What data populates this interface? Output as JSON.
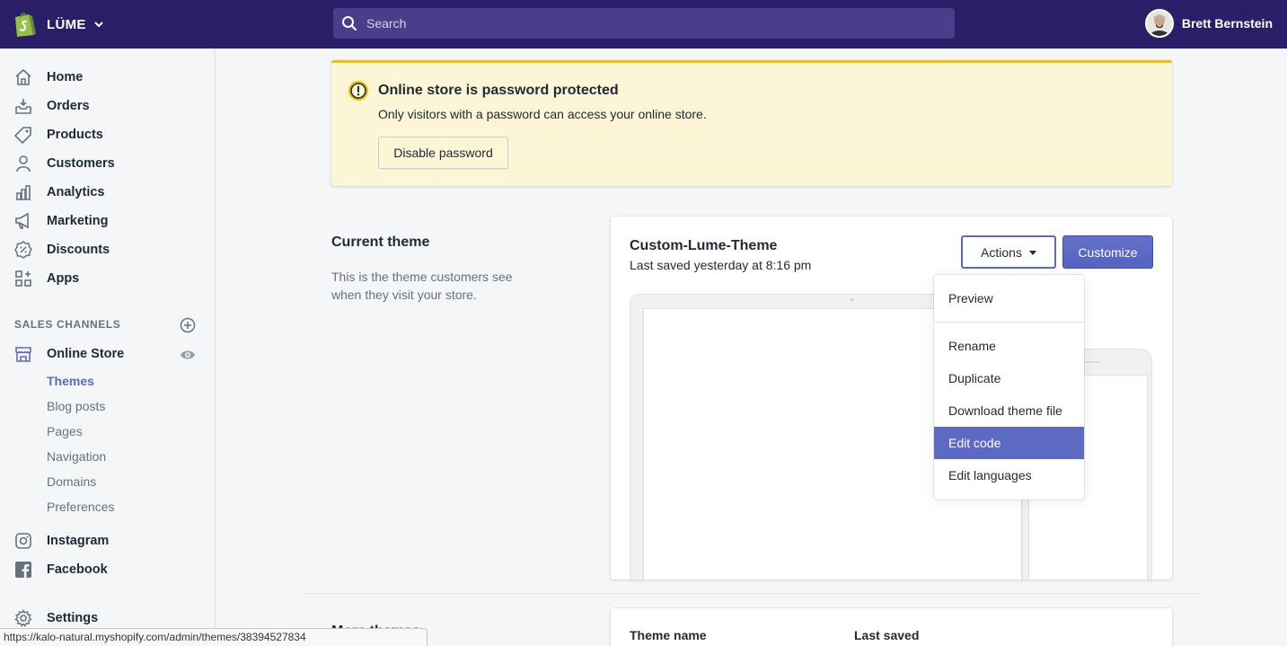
{
  "topbar": {
    "store_name": "LÜME",
    "search_placeholder": "Search",
    "user_name": "Brett Bernstein"
  },
  "sidebar": {
    "items": [
      {
        "label": "Home",
        "icon": "home-icon"
      },
      {
        "label": "Orders",
        "icon": "orders-icon"
      },
      {
        "label": "Products",
        "icon": "tag-icon"
      },
      {
        "label": "Customers",
        "icon": "person-icon"
      },
      {
        "label": "Analytics",
        "icon": "bar-chart-icon"
      },
      {
        "label": "Marketing",
        "icon": "megaphone-icon"
      },
      {
        "label": "Discounts",
        "icon": "discount-icon"
      },
      {
        "label": "Apps",
        "icon": "apps-icon"
      }
    ],
    "sales_channels_heading": "SALES CHANNELS",
    "online_store": "Online Store",
    "sub_items": [
      "Themes",
      "Blog posts",
      "Pages",
      "Navigation",
      "Domains",
      "Preferences"
    ],
    "instagram": "Instagram",
    "facebook": "Facebook",
    "settings": "Settings"
  },
  "banner": {
    "title": "Online store is password protected",
    "text": "Only visitors with a password can access your online store.",
    "button": "Disable password"
  },
  "current_theme": {
    "section_title": "Current theme",
    "section_desc": "This is the theme customers see when they visit your store.",
    "theme_name": "Custom-Lume-Theme",
    "last_saved": "Last saved yesterday at 8:16 pm",
    "actions_label": "Actions",
    "customize_label": "Customize"
  },
  "actions_menu": {
    "items": [
      "Preview",
      "Rename",
      "Duplicate",
      "Download theme file",
      "Edit code",
      "Edit languages"
    ],
    "active": "Edit code"
  },
  "library": {
    "title_partial": "More themes",
    "col_theme_name": "Theme name",
    "col_last_saved": "Last saved"
  },
  "status_bar": {
    "url": "https://kalo-natural.myshopify.com/admin/themes/38394527834"
  },
  "colors": {
    "topbar": "#2b1e69",
    "accent": "#5c6ac4",
    "banner_bg": "#fcf5d6",
    "banner_border": "#eec200"
  }
}
